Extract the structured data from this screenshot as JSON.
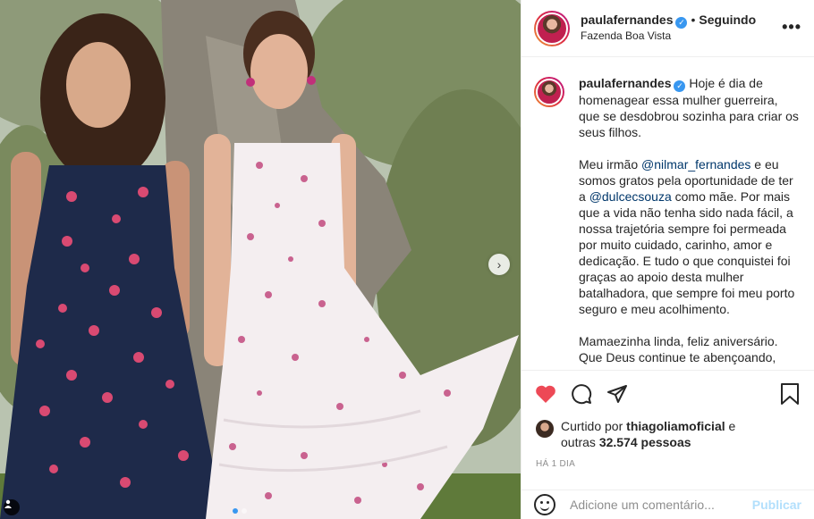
{
  "post": {
    "username": "paulafernandes",
    "verified_icon": "verified-badge-icon",
    "separator": "•",
    "follow_status": "Seguindo",
    "location": "Fazenda Boa Vista",
    "more_icon": "more-options-icon"
  },
  "caption": {
    "username": "paulafernandes",
    "p1": "Hoje é dia de homenagear essa mulher guerreira, que se desdobrou sozinha para criar os seus filhos.",
    "p2_a": "Meu irmão ",
    "p2_mention1": "@nilmar_fernandes",
    "p2_b": " e eu somos gratos pela oportunidade de ter a ",
    "p2_mention2": "@dulcecsouza",
    "p2_c": " como mãe. Por mais que a vida não tenha sido nada fácil, a nossa trajetória sempre foi permeada por muito cuidado, carinho, amor e dedicação. E tudo o que conquistei foi graças ao apoio desta mulher batalhadora, que sempre foi meu porto seguro e meu acolhimento.",
    "p3_line1": "Mamaezinha linda, feliz aniversário.",
    "p3_line2": "Que Deus continue te abençoando, com"
  },
  "actions": {
    "like_icon": "heart-filled-icon",
    "comment_icon": "comment-icon",
    "share_icon": "share-icon",
    "save_icon": "bookmark-icon",
    "like_color": "#ed4956"
  },
  "likes": {
    "prefix": "Curtido por ",
    "user": "thiagoliamoficial",
    "mid": " e",
    "others_prefix": "outras ",
    "count": "32.574 pessoas"
  },
  "timestamp": "HÁ 1 DIA",
  "comment": {
    "placeholder": "Adicione um comentário...",
    "publish_label": "Publicar",
    "emoji_icon": "emoji-icon"
  },
  "carousel": {
    "next_icon": "chevron-right-icon",
    "next_glyph": "›"
  }
}
